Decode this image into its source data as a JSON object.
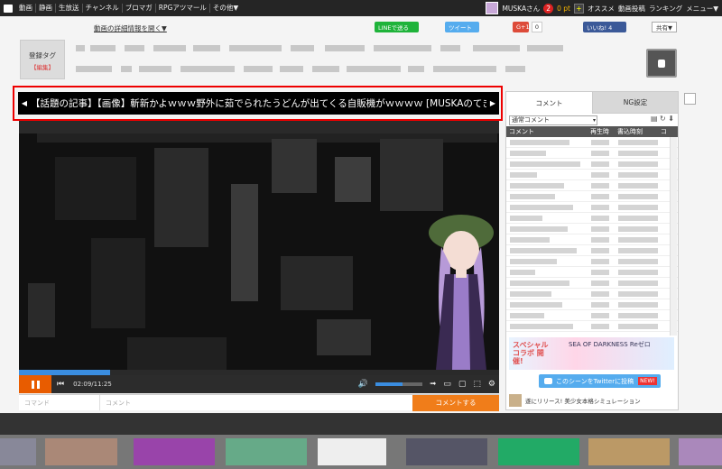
{
  "topbar": {
    "nav": [
      "動画",
      "静画",
      "生放送",
      "チャンネル",
      "ブロマガ",
      "RPGアツマール",
      "その他▼"
    ],
    "user": "MUSKAさん",
    "notifications": "2",
    "points": "0 pt",
    "points_plus": "+",
    "right_links": [
      "オススメ",
      "動画投稿",
      "ランキング",
      "メニュー▼"
    ]
  },
  "subbar": {
    "detail_link": "動画の詳細情報を開く▼",
    "line": "LINEで送る",
    "tweet": "ツイート",
    "gplus": "G+1",
    "gplus_count": "0",
    "fb": "いいね! 4",
    "share": "共有▼"
  },
  "tagbox": {
    "label": "登録タグ",
    "edit": "【編集】"
  },
  "ticker": {
    "prev": "◀",
    "next": "▶",
    "text": "【話題の記事】【画像】斬新かよｗｗｗ野外に茹でられたうどんが出てくる自販機がｗｗｗｗ [MUSKAのてき"
  },
  "player": {
    "time": "02:09/11:25",
    "progress": 0.19,
    "volume": 0.58
  },
  "comment_input": {
    "command_placeholder": "コマンド",
    "comment_placeholder": "コメント",
    "send": "コメントする"
  },
  "side": {
    "tabs": [
      "コメント",
      "NG設定"
    ],
    "select": "通常コメント",
    "columns": [
      "コメント",
      "再生時",
      "書込時刻",
      "コ"
    ],
    "ad_text": "スペシャル コラボ 開催!",
    "ad_logo": "SEA OF DARKNESS  Reゼロ",
    "twitter_btn": "このシーンをTwitterに投稿",
    "new_badge": "NEW!",
    "promo_text": "遂にリリース! 美少女本格シミュレーション"
  },
  "colors": {
    "accent": "#e85c00",
    "highlight": "#e00000",
    "seek": "#3a8de0"
  }
}
